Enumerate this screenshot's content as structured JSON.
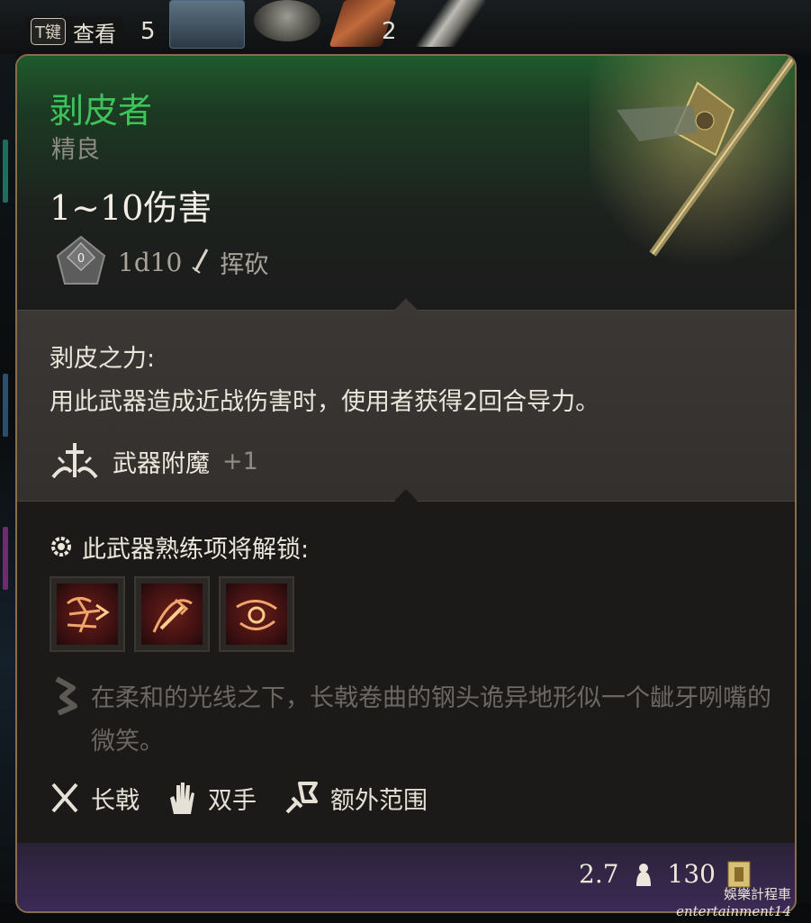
{
  "hotbar": {
    "key_label": "T键",
    "view_label": "查看",
    "count_left": "5",
    "count_right": "2"
  },
  "tooltip": {
    "name": "剥皮者",
    "rarity": "精良",
    "damage": "1~10伤害",
    "damage_dice": "1d10",
    "damage_type": "挥砍",
    "property_title": "剥皮之力:",
    "property_desc": "用此武器造成近战伤害时，使用者获得2回合导力。",
    "enchant_label": "武器附魔",
    "enchant_value": "+1",
    "unlock_label": "此武器熟练项将解锁:",
    "actions": [
      "action-1",
      "action-2",
      "action-3"
    ],
    "lore": "在柔和的光线之下，长戟卷曲的钢头诡异地形似一个龇牙咧嘴的微笑。",
    "tags": [
      "长戟",
      "双手",
      "额外范围"
    ],
    "weight": "2.7",
    "price": "130"
  },
  "watermark": {
    "cn": "娛樂計程車",
    "en": "entertainment14"
  },
  "colors": {
    "item_name": "#3ec35a",
    "border": "#8a6d4c",
    "footer": "#3c2a56"
  }
}
